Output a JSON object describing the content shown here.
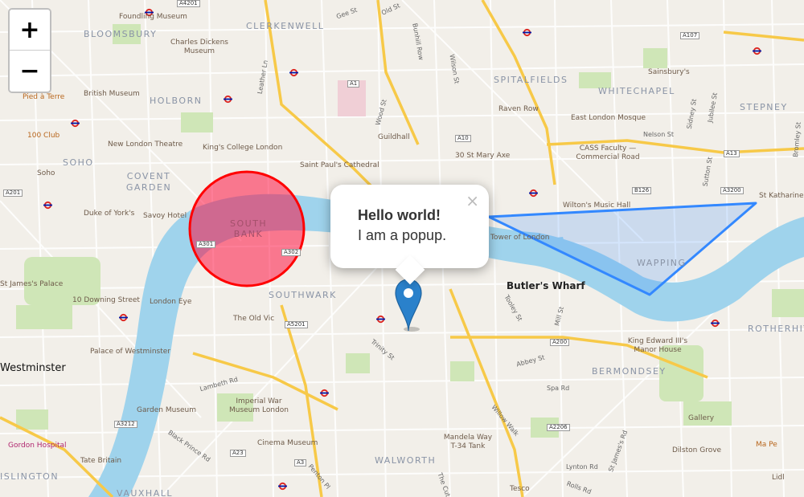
{
  "zoom": {
    "in_label": "+",
    "out_label": "−"
  },
  "popup": {
    "title": "Hello world!",
    "body": "I am a popup.",
    "close_label": "×"
  },
  "map_labels": {
    "districts": [
      "BLOOMSBURY",
      "CLERKENWELL",
      "SPITALFIELDS",
      "WHITECHAPEL",
      "STEPNEY",
      "HOLBORN",
      "SOHO",
      "COVENT GARDEN",
      "SOUTH BANK",
      "SOUTHWARK",
      "WAPPING",
      "BERMONDSEY",
      "ROTHERHITHE",
      "WALWORTH",
      "VAUXHALL",
      "ISLINGTON"
    ],
    "places": [
      "Foundling Museum",
      "Charles Dickens Museum",
      "British Museum",
      "100 Club",
      "New London Theatre",
      "King's College London",
      "Duke of York's",
      "Savoy Hotel",
      "St James's Palace",
      "10 Downing Street",
      "London Eye",
      "The Old Vic",
      "Palace of Westminster",
      "Imperial War Museum London",
      "Garden Museum",
      "Cinema Museum",
      "Tate Britain",
      "Gordon Hospital",
      "Guildhall",
      "Saint Paul's Cathedral",
      "30 St Mary Axe",
      "Raven Row",
      "East London Mosque",
      "CASS Faculty — Commercial Road",
      "Wilton's Music Hall",
      "Tower of London",
      "Sainsbury's",
      "King Edward III's Manor House",
      "Mandela Way T-34 Tank",
      "Gallery",
      "Dilston Grove",
      "Tesco",
      "Ma Pe",
      "Pied à Terre",
      "Soho",
      "Lidl",
      "St Katharine by the..."
    ],
    "bold": [
      "Butler's Wharf",
      "Westminster"
    ],
    "streets": [
      "Gee St",
      "Old St",
      "Bunhill Row",
      "Wilson St",
      "Leather Ln",
      "Wood St",
      "Nelson St",
      "Sidney St",
      "Jubilee St",
      "Bromley St",
      "Sutton St",
      "Trinity St",
      "Lambeth Rd",
      "Black Prince Rd",
      "Penton Pl",
      "Abbey St",
      "Spa Rd",
      "Willow Walk",
      "St James's Rd",
      "Lynton Rd",
      "Rolls Rd",
      "Mill St",
      "Tooley St",
      "The Cut"
    ],
    "roads": [
      "A1",
      "A10",
      "A13",
      "A107",
      "A201",
      "A3",
      "A23",
      "A3212",
      "A2206",
      "A200",
      "A301",
      "A302",
      "B126",
      "A5201",
      "A4201",
      "A3200"
    ]
  },
  "overlays": {
    "circle": {
      "stroke": "#ff0000",
      "fill": "#f03"
    },
    "polygon": {
      "stroke": "#3388ff"
    },
    "marker": {
      "color": "#2a81cb"
    }
  },
  "colors": {
    "land": "#f2efe9",
    "water": "#9fd3ec",
    "park": "#cfe6b7",
    "major_road": "#f7c948"
  }
}
